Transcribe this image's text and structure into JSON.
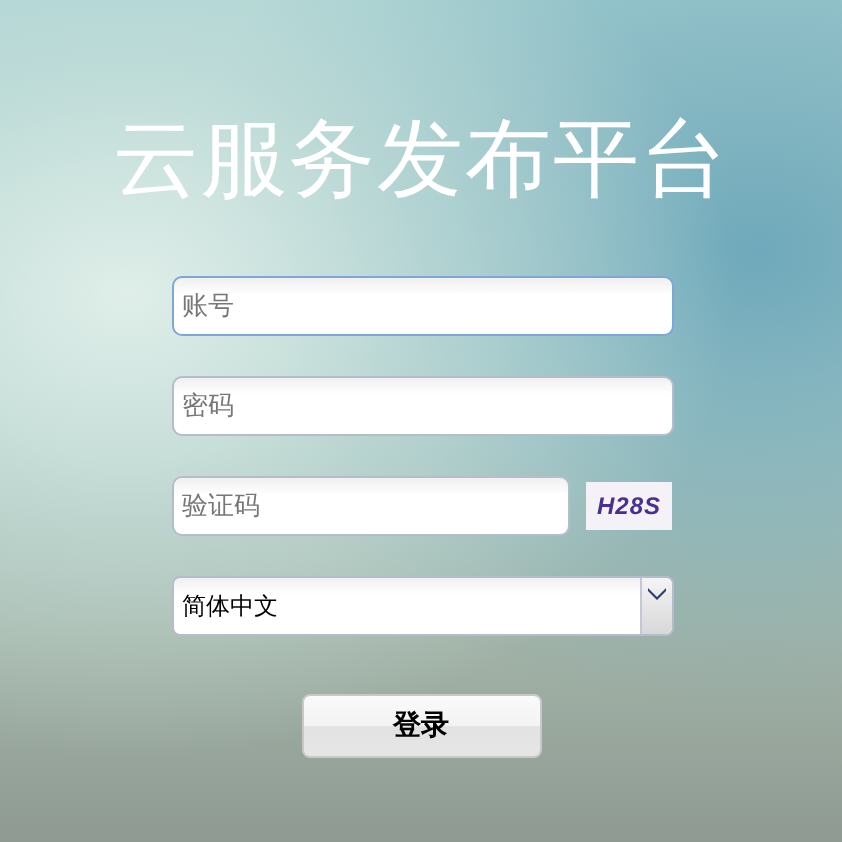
{
  "title": "云服务发布平台",
  "fields": [
    {
      "kind": "text",
      "placeholder": "账号"
    },
    {
      "kind": "password",
      "placeholder": "密码"
    },
    {
      "kind": "captcha",
      "placeholder": "验证码",
      "code": "H28S"
    }
  ],
  "language": {
    "value": "简体中文"
  },
  "button": "登录"
}
